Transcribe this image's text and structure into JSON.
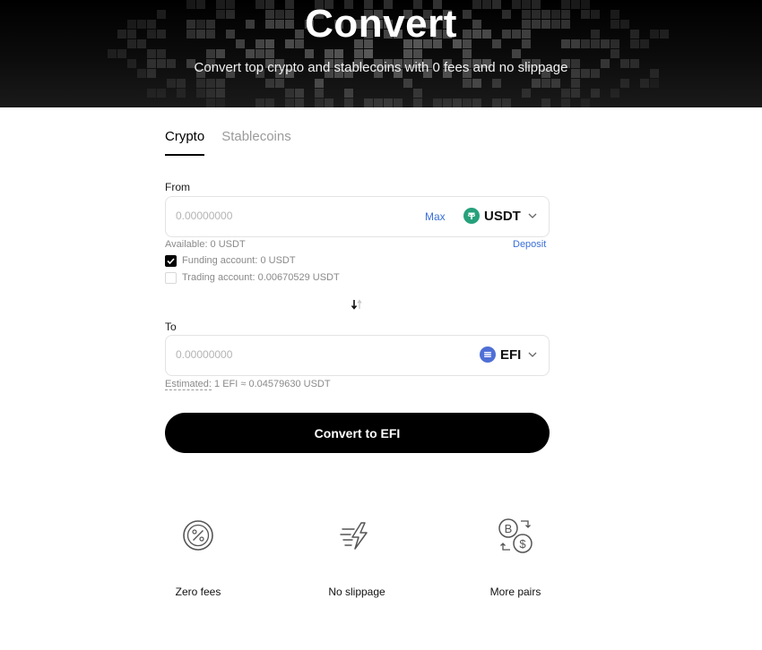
{
  "hero": {
    "title": "Convert",
    "subtitle": "Convert top crypto and stablecoins with 0 fees and no slippage"
  },
  "tabs": [
    {
      "label": "Crypto",
      "active": true
    },
    {
      "label": "Stablecoins",
      "active": false
    }
  ],
  "from": {
    "label": "From",
    "placeholder": "0.00000000",
    "max_label": "Max",
    "coin": "USDT",
    "coin_color": "#26a17b",
    "available": "Available: 0 USDT",
    "deposit_label": "Deposit",
    "funding_account": {
      "label": "Funding account: 0 USDT",
      "checked": true
    },
    "trading_account": {
      "label": "Trading account: 0.00670529 USDT",
      "checked": false
    }
  },
  "to": {
    "label": "To",
    "placeholder": "0.00000000",
    "coin": "EFI",
    "coin_color": "#4f6fd6",
    "estimate_label": "Estimated:",
    "estimate_value": "1 EFI ≈ 0.04579630 USDT"
  },
  "convert_button": "Convert to EFI",
  "features": [
    {
      "label": "Zero fees",
      "icon": "percent-badge-icon"
    },
    {
      "label": "No slippage",
      "icon": "lightning-speed-icon"
    },
    {
      "label": "More pairs",
      "icon": "coin-exchange-icon"
    }
  ],
  "colors": {
    "accent_link": "#3a6fd8",
    "button": "#000000",
    "muted_text": "#8a8a8a"
  }
}
